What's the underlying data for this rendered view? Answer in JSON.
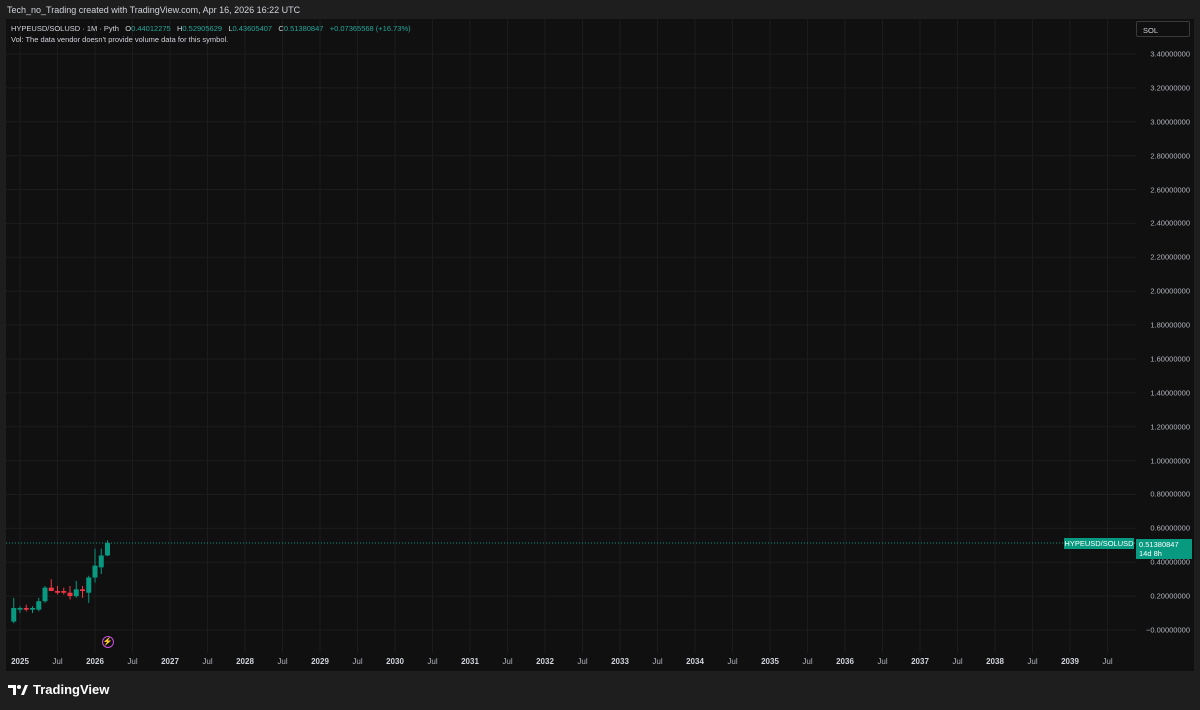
{
  "header": {
    "caption": "Tech_no_Trading created with TradingView.com, Apr 16, 2026 16:22 UTC"
  },
  "legend": {
    "symbol": "HYPEUSD/SOLUSD · 1M · Pyth",
    "o_label": "O",
    "o": "0.44012275",
    "h_label": "H",
    "h": "0.52905629",
    "l_label": "L",
    "l": "0.43605407",
    "c_label": "C",
    "c": "0.51380847",
    "change": "+0.07365568 (+16.73%)"
  },
  "volume_note": "Vol: The data vendor doesn't provide volume data for this symbol.",
  "compare_symbol": "SOL",
  "price_tag": {
    "symbol": "HYPEUSD/SOLUSD",
    "price": "0.51380847",
    "countdown": "14d 8h"
  },
  "footer": {
    "brand": "TradingView"
  },
  "icons": {
    "event_marker": "lightning-icon",
    "logo": "tradingview-logo-icon"
  },
  "colors": {
    "up": "#089981",
    "down": "#f23645",
    "price_line": "#089981"
  },
  "chart_data": {
    "type": "candlestick",
    "title": "",
    "interval": "1M",
    "y_ticks": [
      "3.40000000",
      "3.20000000",
      "3.00000000",
      "2.80000000",
      "2.60000000",
      "2.40000000",
      "2.20000000",
      "2.00000000",
      "1.80000000",
      "1.60000000",
      "1.40000000",
      "1.20000000",
      "1.00000000",
      "0.80000000",
      "0.60000000",
      "0.40000000",
      "0.20000000",
      "−0.00000000"
    ],
    "ylim": [
      -0.05,
      3.55
    ],
    "x_ticks": [
      "2025",
      "Jul",
      "2026",
      "Jul",
      "2027",
      "Jul",
      "2028",
      "Jul",
      "2029",
      "Jul",
      "2030",
      "Jul",
      "2031",
      "Jul",
      "2032",
      "Jul",
      "2033",
      "Jul",
      "2034",
      "Jul",
      "2035",
      "Jul",
      "2036",
      "Jul",
      "2037",
      "Jul",
      "2038",
      "Jul",
      "2039",
      "Jul"
    ],
    "x_year_ticks": [
      "2025",
      "2026",
      "2027",
      "2028",
      "2029",
      "2030",
      "2031",
      "2032",
      "2033",
      "2034",
      "2035",
      "2036",
      "2037",
      "2038",
      "2039"
    ],
    "grid": true,
    "last_price": 0.51380847,
    "candles": [
      {
        "t": "2024-12",
        "o": 0.05,
        "h": 0.19,
        "l": 0.04,
        "c": 0.13
      },
      {
        "t": "2025-01",
        "o": 0.12,
        "h": 0.14,
        "l": 0.1,
        "c": 0.13
      },
      {
        "t": "2025-02",
        "o": 0.13,
        "h": 0.15,
        "l": 0.11,
        "c": 0.12
      },
      {
        "t": "2025-03",
        "o": 0.12,
        "h": 0.14,
        "l": 0.1,
        "c": 0.13
      },
      {
        "t": "2025-04",
        "o": 0.12,
        "h": 0.19,
        "l": 0.11,
        "c": 0.17
      },
      {
        "t": "2025-05",
        "o": 0.17,
        "h": 0.26,
        "l": 0.16,
        "c": 0.25
      },
      {
        "t": "2025-06",
        "o": 0.25,
        "h": 0.3,
        "l": 0.23,
        "c": 0.23
      },
      {
        "t": "2025-07",
        "o": 0.23,
        "h": 0.26,
        "l": 0.21,
        "c": 0.22
      },
      {
        "t": "2025-08",
        "o": 0.23,
        "h": 0.25,
        "l": 0.21,
        "c": 0.22
      },
      {
        "t": "2025-09",
        "o": 0.22,
        "h": 0.26,
        "l": 0.18,
        "c": 0.2
      },
      {
        "t": "2025-10",
        "o": 0.2,
        "h": 0.29,
        "l": 0.19,
        "c": 0.24
      },
      {
        "t": "2025-11",
        "o": 0.24,
        "h": 0.26,
        "l": 0.19,
        "c": 0.23
      },
      {
        "t": "2025-12",
        "o": 0.22,
        "h": 0.32,
        "l": 0.16,
        "c": 0.31
      },
      {
        "t": "2026-01",
        "o": 0.31,
        "h": 0.48,
        "l": 0.28,
        "c": 0.38
      },
      {
        "t": "2026-02",
        "o": 0.37,
        "h": 0.48,
        "l": 0.33,
        "c": 0.44
      },
      {
        "t": "2026-03",
        "o": 0.44012275,
        "h": 0.52905629,
        "l": 0.43605407,
        "c": 0.51380847
      }
    ]
  }
}
